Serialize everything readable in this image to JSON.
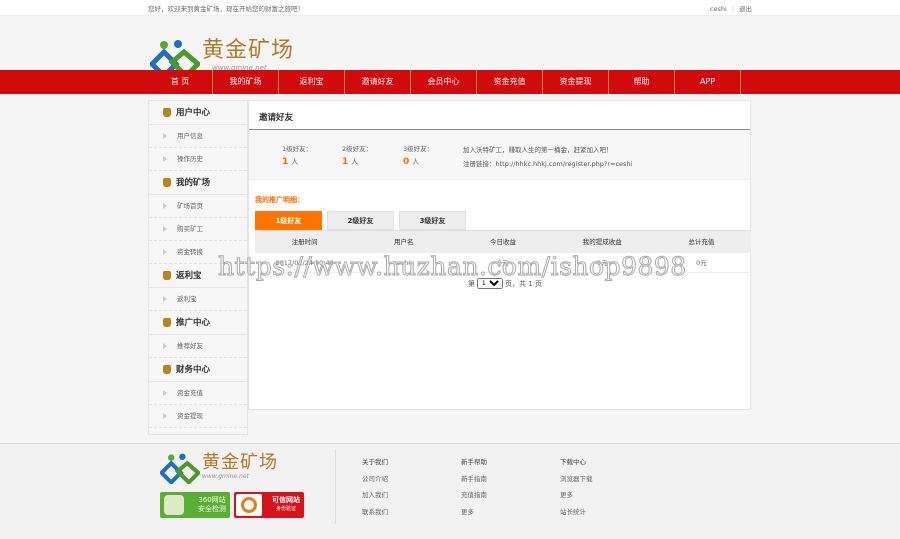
{
  "topbar": {
    "welcome": "您好，欢迎来到黄金矿场，现在开始您的财富之旅吧！",
    "user": "ceshi",
    "sep": "|",
    "logout": "退出"
  },
  "brand": {
    "name": "黄金矿场",
    "url": "www.gmine.net"
  },
  "nav": [
    "首 页",
    "我的矿场",
    "返利宝",
    "邀请好友",
    "会员中心",
    "资金充值",
    "资金提现",
    "帮助",
    "APP"
  ],
  "sidebar": [
    {
      "title": "用户中心",
      "items": [
        "用户信息",
        "操作历史"
      ]
    },
    {
      "title": "我的矿场",
      "items": [
        "矿场首页",
        "购买矿工",
        "资金转换"
      ]
    },
    {
      "title": "返利宝",
      "items": [
        "返利宝"
      ]
    },
    {
      "title": "推广中心",
      "items": [
        "推荐好友"
      ]
    },
    {
      "title": "财务中心",
      "items": [
        "资金充值",
        "资金提现"
      ]
    }
  ],
  "main": {
    "title": "邀请好友",
    "stats": [
      {
        "label": "1级好友：",
        "value": "1",
        "unit": "人"
      },
      {
        "label": "2级好友：",
        "value": "1",
        "unit": "人"
      },
      {
        "label": "3级好友：",
        "value": "0",
        "unit": "人"
      }
    ],
    "slogan": "加入沃特矿工，赚取人生的第一桶金，赶紧加入吧！",
    "link": "注册链接：http://hhkc.hhkj.com/register.php?r=ceshi",
    "promo_title": "我的推广明细：",
    "tabs": [
      "1级好友",
      "2级好友",
      "3级好友"
    ],
    "columns": [
      "注册时间",
      "用户名",
      "今日收益",
      "我的提成收益",
      "总计充值"
    ],
    "rows": [
      [
        "2017/02/24 10:49",
        "ceshia",
        "0元",
        "0元",
        "0元"
      ]
    ],
    "pager": {
      "prefix": "第",
      "page": "1",
      "suffix": "页，共",
      "total": "1",
      "end": "页"
    }
  },
  "watermark": "https://www.huzhan.com/ishop9898",
  "footer": {
    "badges": [
      {
        "line1": "360网站",
        "line2": "安全检测"
      },
      {
        "line1": "可信网站",
        "line2": "身份验证"
      }
    ],
    "cols": [
      [
        "关于我们",
        "公司介绍",
        "加入我们",
        "联系我们"
      ],
      [
        "新手帮助",
        "新手指南",
        "充值指南",
        "更多"
      ],
      [
        "下载中心",
        "浏览器下载",
        "更多",
        "站长统计"
      ]
    ]
  },
  "colors": {
    "nav": "#d10b0b",
    "accent": "#ff7300",
    "brand": "#b07a2a"
  }
}
